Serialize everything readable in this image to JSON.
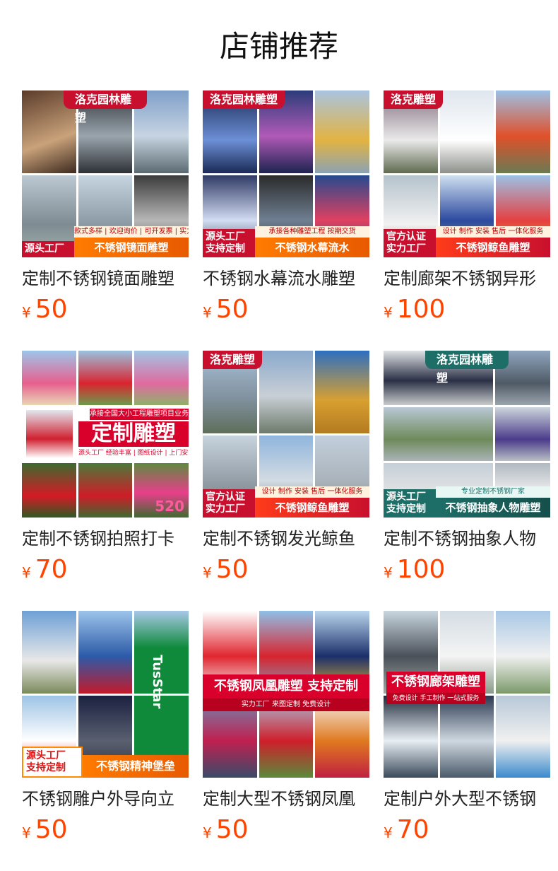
{
  "header": {
    "title": "店铺推荐"
  },
  "products": [
    {
      "name": "定制不锈钢镜面雕塑",
      "currency": "¥",
      "price": "50",
      "image": {
        "brand": "洛克园林雕塑",
        "badge": "源头工厂",
        "strip": "款式多样 | 欢迎询价 | 可开发票 | 实力商家",
        "ribbon": "不锈钢镜面雕塑"
      }
    },
    {
      "name": "不锈钢水幕流水雕塑",
      "currency": "¥",
      "price": "50",
      "image": {
        "brand": "洛克园林雕塑",
        "badge": "源头工厂 支持定制",
        "strip": "承接各种雕塑工程 按期交货",
        "ribbon": "不锈钢水幕流水"
      }
    },
    {
      "name": "定制廊架不锈钢异形",
      "currency": "¥",
      "price": "100",
      "image": {
        "brand": "洛克雕塑",
        "badge": "官方认证 实力工厂",
        "strip": "设计 制作 安装 售后 一体化服务",
        "ribbon": "不锈钢鲸鱼雕塑"
      }
    },
    {
      "name": "定制不锈钢拍照打卡",
      "currency": "¥",
      "price": "70",
      "image": {
        "top_line": "承接全国大小工程雕塑项目业务",
        "banner": "定制雕塑",
        "sub_line": "源头工厂 经验丰富 | 图纸设计 | 上门安装",
        "corner": "520"
      }
    },
    {
      "name": "定制不锈钢发光鲸鱼",
      "currency": "¥",
      "price": "50",
      "image": {
        "brand": "洛克雕塑",
        "badge": "官方认证 实力工厂",
        "strip": "设计 制作 安装 售后 一体化服务",
        "ribbon": "不锈钢鲸鱼雕塑"
      }
    },
    {
      "name": "定制不锈钢抽象人物",
      "currency": "¥",
      "price": "100",
      "image": {
        "brand": "洛克园林雕塑",
        "badge": "源头工厂 支持定制",
        "strip": "专业定制不锈钢厂家",
        "ribbon": "不锈钢抽象人物雕塑"
      }
    },
    {
      "name": "不锈钢雕户外导向立",
      "currency": "¥",
      "price": "50",
      "image": {
        "badge": "源头工厂 支持定制",
        "ribbon": "不锈钢精神堡垒",
        "sign": "TusStar"
      }
    },
    {
      "name": "定制大型不锈钢凤凰",
      "currency": "¥",
      "price": "50",
      "image": {
        "banner": "不锈钢凤凰雕塑  支持定制",
        "sub_line": "实力工厂  来图定制  免费设计"
      }
    },
    {
      "name": "定制户外大型不锈钢",
      "currency": "¥",
      "price": "70",
      "image": {
        "banner": "不锈钢廊架雕塑",
        "sub_line": "免费设计 手工制作 一站式服务"
      }
    }
  ],
  "colors": {
    "price": "#ff4400",
    "brand_red": "#c8102e"
  }
}
